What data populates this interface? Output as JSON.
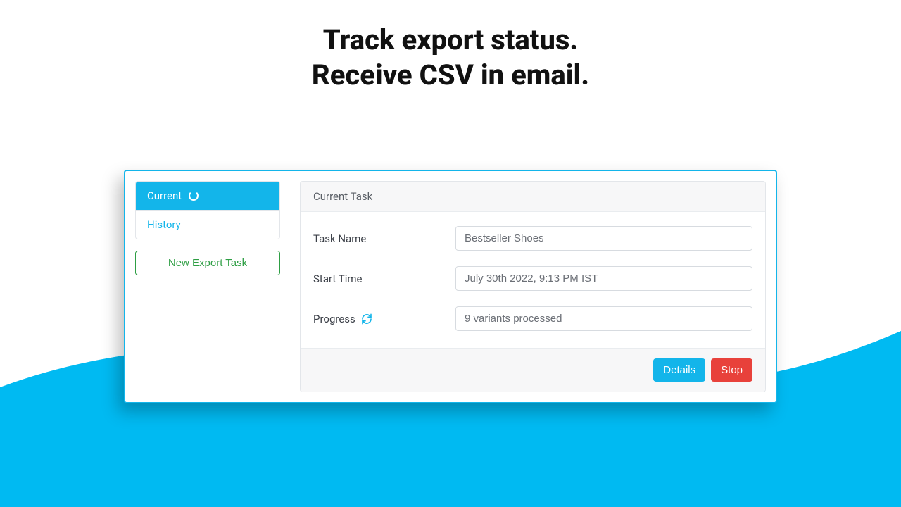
{
  "heading": {
    "line1": "Track export status.",
    "line2": "Receive CSV in email."
  },
  "sidebar": {
    "items": [
      {
        "label": "Current",
        "active": true
      },
      {
        "label": "History",
        "active": false
      }
    ],
    "new_task_label": "New Export Task"
  },
  "card": {
    "header": "Current Task",
    "fields": {
      "task_name_label": "Task Name",
      "task_name_value": "Bestseller Shoes",
      "start_time_label": "Start Time",
      "start_time_value": "July 30th 2022, 9:13 PM IST",
      "progress_label": "Progress",
      "progress_value": "9 variants processed"
    },
    "footer": {
      "details_label": "Details",
      "stop_label": "Stop"
    }
  },
  "colors": {
    "accent": "#13b5ea",
    "danger": "#e8413b",
    "success": "#2e9e44"
  }
}
